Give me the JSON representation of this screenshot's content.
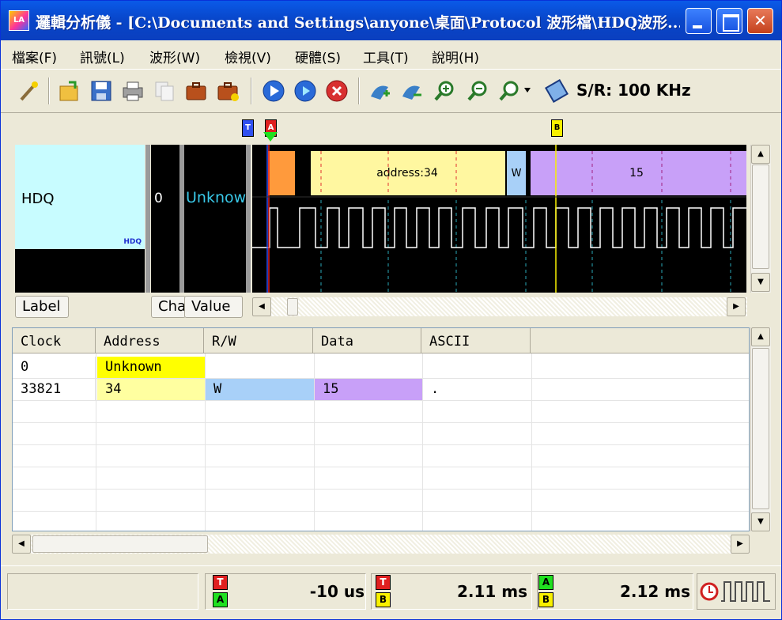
{
  "window": {
    "title": "邏輯分析儀 - [C:\\Documents and Settings\\anyone\\桌面\\Protocol 波形檔\\HDQ波形...",
    "app_icon_text": "LA"
  },
  "menu": {
    "items": [
      "檔案(F)",
      "訊號(L)",
      "波形(W)",
      "檢視(V)",
      "硬體(S)",
      "工具(T)",
      "說明(H)"
    ]
  },
  "toolbar": {
    "sample_rate": "S/R: 100 KHz"
  },
  "markers": {
    "t_label": "T",
    "a_label": "A",
    "b_label": "B"
  },
  "channel": {
    "label": "HDQ",
    "label_small": "HDQ",
    "channel_number": "0",
    "value": "Unknown"
  },
  "waveform": {
    "decode_address": "address:34",
    "decode_rw": "W",
    "decode_data": "15"
  },
  "tabs": {
    "label": "Label",
    "channel": "Channel",
    "value": "Value"
  },
  "table": {
    "headers": [
      "Clock",
      "Address",
      "R/W",
      "Data",
      "ASCII"
    ],
    "rows": [
      {
        "clock": "0",
        "address": "Unknown",
        "rw": "",
        "data": "",
        "ascii": ""
      },
      {
        "clock": "33821",
        "address": "34",
        "rw": "W",
        "data": "15",
        "ascii": "."
      }
    ]
  },
  "status": {
    "t_a_label_top": "T",
    "t_a_label_bottom": "A",
    "t_a_value": "-10 us",
    "t_b_label_top": "T",
    "t_b_label_bottom": "B",
    "t_b_value": "2.11 ms",
    "a_b_label_top": "A",
    "a_b_label_bottom": "B",
    "a_b_value": "2.12 ms"
  },
  "colors": {
    "title_bar": "#0A5AE8",
    "label_bg": "#C8FCFF",
    "decode_orange": "#FF9A3C",
    "decode_yellow": "#FFF7A0",
    "decode_blue": "#A8D0F8",
    "decode_purple": "#C8A0F8",
    "address_cell": "#FFFF00",
    "address_cell_light": "#FFFFA0",
    "rw_cell": "#A8D0F8",
    "data_cell": "#C8A0F8"
  }
}
